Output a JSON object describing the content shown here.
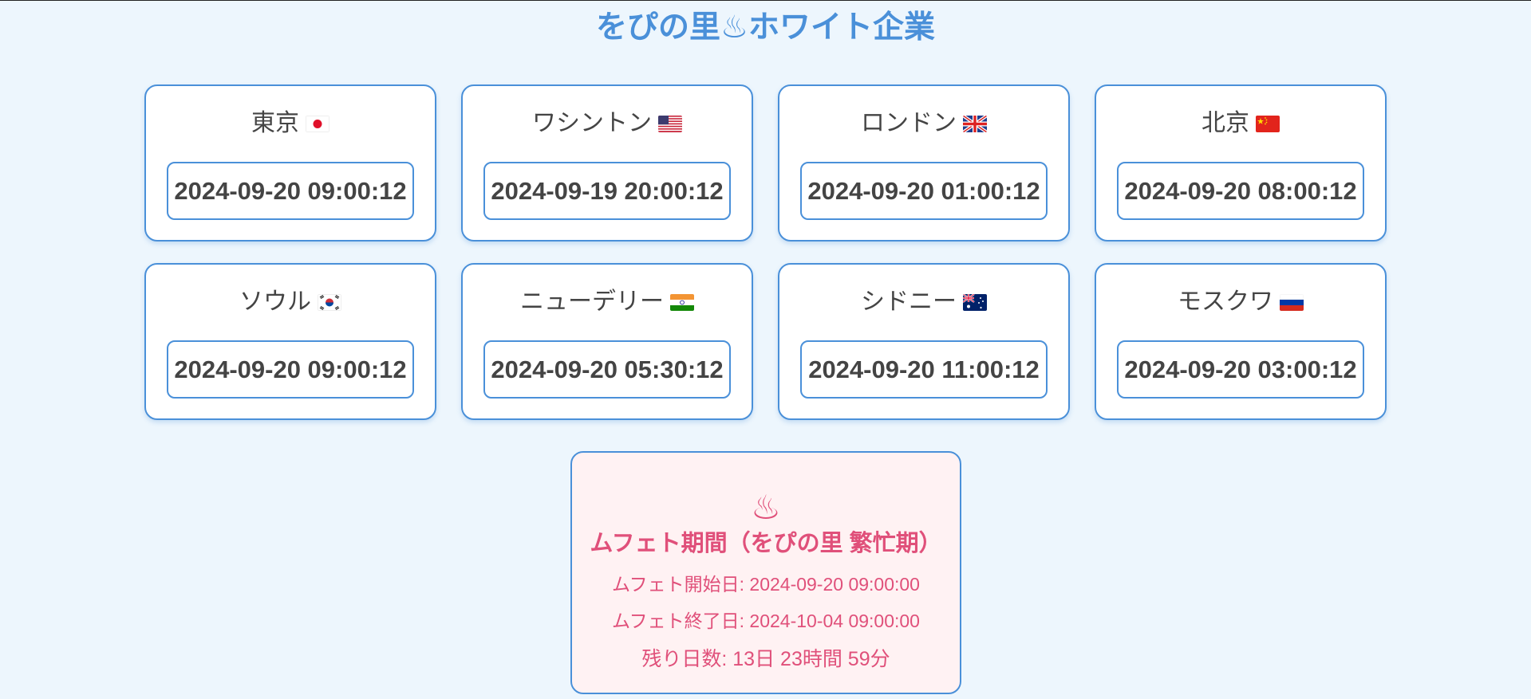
{
  "header": {
    "title": "をぴの里♨ホワイト企業"
  },
  "clocks": [
    {
      "city": "東京",
      "flag": "japan-flag-icon",
      "time": "2024-09-20 09:00:12"
    },
    {
      "city": "ワシントン",
      "flag": "usa-flag-icon",
      "time": "2024-09-19 20:00:12"
    },
    {
      "city": "ロンドン",
      "flag": "uk-flag-icon",
      "time": "2024-09-20 01:00:12"
    },
    {
      "city": "北京",
      "flag": "china-flag-icon",
      "time": "2024-09-20 08:00:12"
    },
    {
      "city": "ソウル",
      "flag": "korea-flag-icon",
      "time": "2024-09-20 09:00:12"
    },
    {
      "city": "ニューデリー",
      "flag": "india-flag-icon",
      "time": "2024-09-20 05:30:12"
    },
    {
      "city": "シドニー",
      "flag": "australia-flag-icon",
      "time": "2024-09-20 11:00:12"
    },
    {
      "city": "モスクワ",
      "flag": "russia-flag-icon",
      "time": "2024-09-20 03:00:12"
    }
  ],
  "buffet": {
    "icon": "♨",
    "title": "ムフェト期間（をぴの里 繁忙期）",
    "start": "ムフェト開始日: 2024-09-20 09:00:00",
    "end": "ムフェト終了日: 2024-10-04 09:00:00",
    "remaining": "残り日数: 13日 23時間 59分"
  },
  "colors": {
    "accent": "#4a90d9",
    "background": "#edf6fd",
    "buffet_text": "#e0507a",
    "buffet_background": "#fff2f3"
  }
}
